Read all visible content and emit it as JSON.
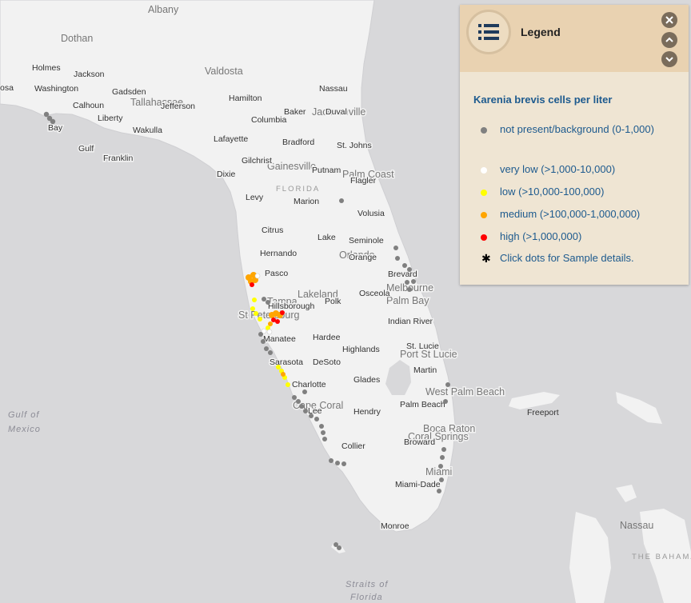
{
  "map": {
    "labels": {
      "albany": "Albany",
      "dothan": "Dothan",
      "valdosta": "Valdosta",
      "tallahassee": "Tallahassee",
      "jacksonville": "Jacksonville",
      "gainesville": "Gainesville",
      "palm_coast": "Palm Coast",
      "florida": "FLORIDA",
      "orlando": "Orlando",
      "lakeland": "Lakeland",
      "tampa": "Tampa",
      "st_petersburg": "St Petersburg",
      "melbourne": "Melbourne",
      "palm_bay": "Palm Bay",
      "port_st_lucie": "Port St Lucie",
      "west_palm_beach": "West Palm Beach",
      "boca_raton": "Boca Raton",
      "coral_springs": "Coral Springs",
      "miami": "Miami",
      "cape_coral": "Cape Coral",
      "nassau_bahamas": "Nassau",
      "the_bahamas": "THE BAHAMA",
      "gulf_of_mexico_1": "Gulf of",
      "gulf_of_mexico_2": "Mexico",
      "straits_1": "Straits of",
      "straits_2": "Florida",
      "freeport": "Freeport",
      "holmes": "Holmes",
      "jackson": "Jackson",
      "washington": "Washington",
      "gadsden": "Gadsden",
      "calhoun": "Calhoun",
      "jefferson": "Jefferson",
      "liberty": "Liberty",
      "bay": "Bay",
      "wakulla": "Wakulla",
      "gulf": "Gulf",
      "franklin": "Franklin",
      "hamilton": "Hamilton",
      "nassau": "Nassau",
      "baker": "Baker",
      "duval": "Duval",
      "columbia": "Columbia",
      "lafayette": "Lafayette",
      "bradford": "Bradford",
      "st_johns": "St. Johns",
      "gilchrist": "Gilchrist",
      "putnam": "Putnam",
      "dixie": "Dixie",
      "flagler": "Flagler",
      "levy": "Levy",
      "marion": "Marion",
      "volusia": "Volusia",
      "citrus": "Citrus",
      "lake": "Lake",
      "seminole": "Seminole",
      "hernando": "Hernando",
      "orange": "Orange",
      "pasco": "Pasco",
      "brevard": "Brevard",
      "hillsborough": "Hillsborough",
      "polk": "Polk",
      "osceola": "Osceola",
      "indian_river": "Indian River",
      "manatee": "Manatee",
      "hardee": "Hardee",
      "highlands": "Highlands",
      "st_lucie": "St. Lucie",
      "sarasota": "Sarasota",
      "desoto": "DeSoto",
      "martin": "Martin",
      "charlotte": "Charlotte",
      "glades": "Glades",
      "palm_beach": "Palm Beach",
      "lee": "Lee",
      "hendry": "Hendry",
      "broward": "Broward",
      "collier": "Collier",
      "miami_dade": "Miami-Dade",
      "monroe": "Monroe",
      "osa": "osa"
    }
  },
  "legend": {
    "title": "Legend",
    "heading": "Karenia brevis cells per liter",
    "items": [
      {
        "label": "not present/background (0-1,000)",
        "color": "#808080"
      },
      {
        "label": "very low (>1,000-10,000)",
        "color": "#ffffff"
      },
      {
        "label": "low (>10,000-100,000)",
        "color": "#ffff00"
      },
      {
        "label": "medium (>100,000-1,000,000)",
        "color": "#ffa500"
      },
      {
        "label": "high (>1,000,000)",
        "color": "#ff0000"
      },
      {
        "label": "Click dots for Sample details.",
        "color": "#000000"
      }
    ]
  },
  "colors": {
    "water": "#d8d8da",
    "land": "#f2f2f2",
    "legend_header": "#e9d2b1",
    "legend_body": "#efe5d3",
    "legend_text": "#1d5a8e"
  }
}
